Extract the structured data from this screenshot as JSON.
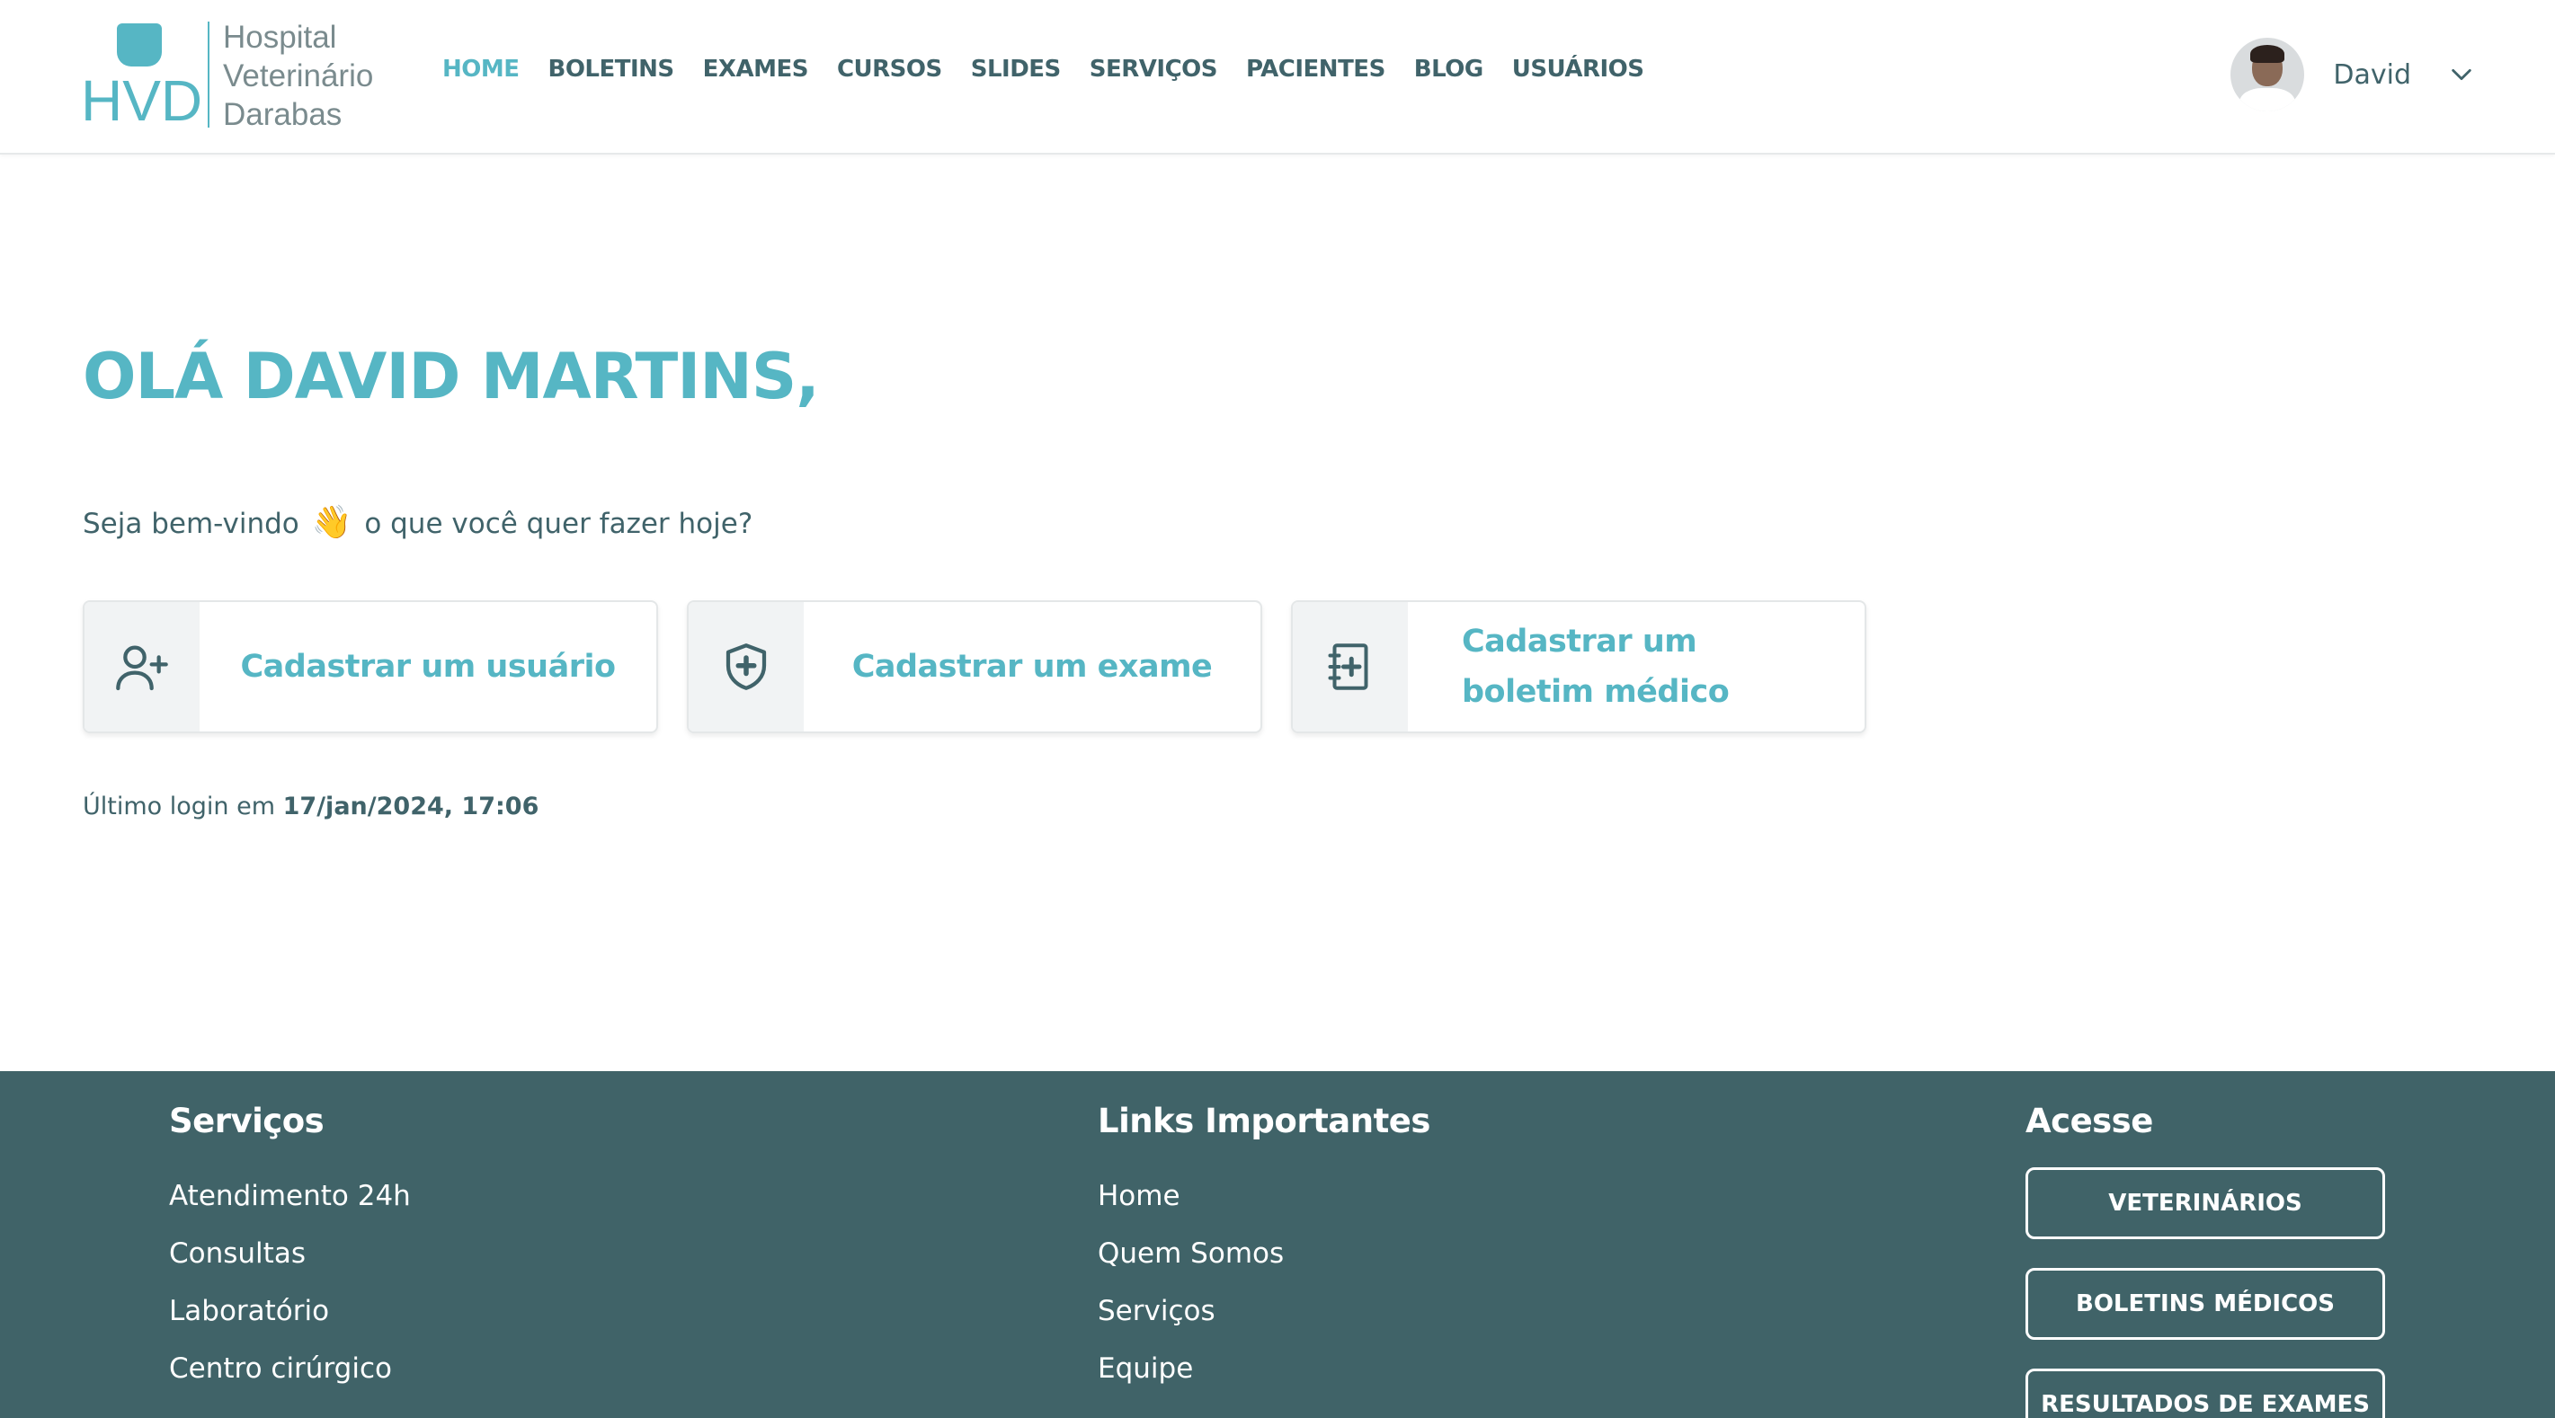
{
  "logo": {
    "abbr": "HVD",
    "line1": "Hospital",
    "line2": "Veterinário",
    "line3": "Darabas",
    "brand_color": "#56b6c4"
  },
  "nav": {
    "items": [
      {
        "label": "HOME",
        "active": true
      },
      {
        "label": "BOLETINS"
      },
      {
        "label": "EXAMES"
      },
      {
        "label": "CURSOS"
      },
      {
        "label": "SLIDES"
      },
      {
        "label": "SERVIÇOS"
      },
      {
        "label": "PACIENTES"
      },
      {
        "label": "BLOG"
      },
      {
        "label": "USUÁRIOS"
      }
    ]
  },
  "user": {
    "name": "David",
    "menu_icon": "chevron-down-icon"
  },
  "main": {
    "greeting": "OLÁ DAVID MARTINS,",
    "welcome_before": "Seja bem-vindo",
    "welcome_emoji": "👋",
    "welcome_after": "o que você quer fazer hoje?",
    "cards": [
      {
        "label": "Cadastrar um usuário",
        "icon": "user-plus-icon"
      },
      {
        "label": "Cadastrar um exame",
        "icon": "shield-plus-icon"
      },
      {
        "label": "Cadastrar um boletim médico",
        "icon": "notebook-plus-icon"
      }
    ],
    "last_login_prefix": "Último login em",
    "last_login_value": "17/jan/2024, 17:06"
  },
  "footer": {
    "services": {
      "title": "Serviços",
      "items": [
        "Atendimento 24h",
        "Consultas",
        "Laboratório",
        "Centro cirúrgico"
      ]
    },
    "links": {
      "title": "Links Importantes",
      "items": [
        "Home",
        "Quem Somos",
        "Serviços",
        "Equipe"
      ]
    },
    "access": {
      "title": "Acesse",
      "buttons": [
        "VETERINÁRIOS",
        "BOLETINS MÉDICOS",
        "RESULTADOS DE EXAMES"
      ]
    },
    "background": "#406368"
  },
  "colors": {
    "accent": "#56b6c4",
    "text": "#40636a"
  }
}
